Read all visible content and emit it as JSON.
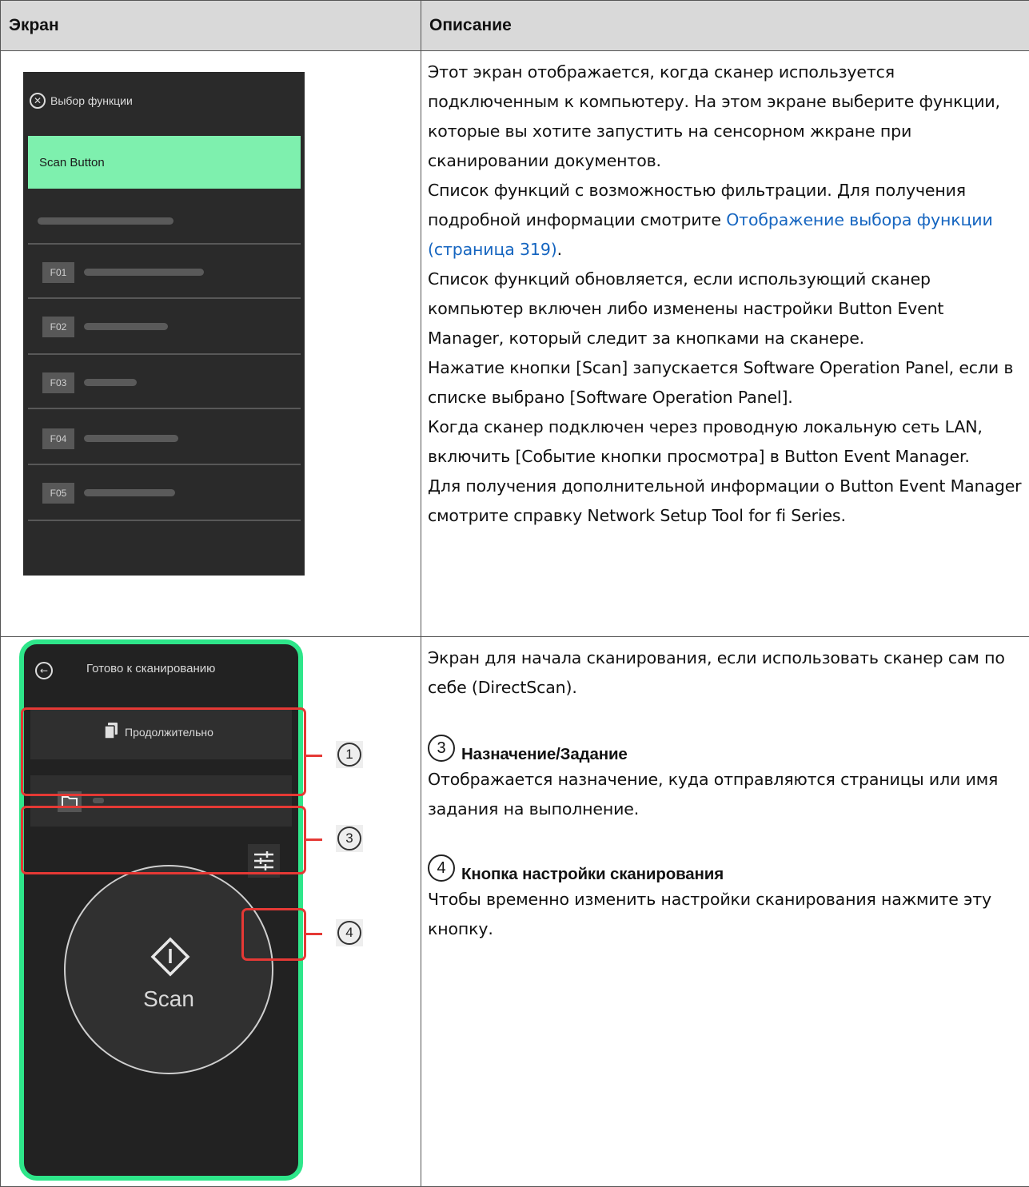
{
  "table": {
    "headers": [
      "Экран",
      "Описание"
    ]
  },
  "row1": {
    "screen": {
      "title": "Выбор функции",
      "selected_item": "Scan Button",
      "function_keys": [
        "F01",
        "F02",
        "F03",
        "F04",
        "F05"
      ]
    },
    "description": {
      "p1": "Этот экран отображается, когда сканер используется подключенным к компьютеру. На этом экране выберите функции, которые вы хотите запустить на сенсорном жкране при сканировании документов.",
      "p2_text": "Список функций с возможностью фильтрации. Для получения подробной информации смотрите ",
      "p2_link": "Отображение выбора функции (страница 319)",
      "p2_end": ".",
      "p3": "Список функций обновляется, если использующий сканер компьютер включен либо изменены настройки Button Event Manager, который следит за кнопками на сканере.",
      "p4": "Нажатие кнопки [Scan] запускается Software Operation Panel, если в списке выбрано [Software Operation Panel].",
      "p5": "Когда сканер подключен через проводную локальную сеть LAN, включить [Событие кнопки просмотра] в Button Event Manager.",
      "p6": "Для получения дополнительной информации о Button Event Manager смотрите справку Network Setup Tool for fi Series."
    }
  },
  "row2": {
    "screen": {
      "title": "Готово к сканированию",
      "continuous_label": "Продолжительно",
      "scan_label": "Scan",
      "callouts": [
        "1",
        "3",
        "4"
      ]
    },
    "description": {
      "intro": "Экран для начала сканирования, если использовать сканер сам по себе (DirectScan).",
      "items": [
        {
          "num": "3",
          "title": "Назначение/Задание",
          "text": "Отображается назначение, куда отправляются страницы или имя задания на выполнение."
        },
        {
          "num": "4",
          "title": "Кнопка настройки сканирования",
          "text": "Чтобы временно изменить настройки сканирования нажмите эту кнопку."
        }
      ]
    }
  },
  "colors": {
    "header_bg": "#d9d9d9",
    "link": "#1565c0",
    "accent_green": "#2ee68a",
    "selected_green": "#7ef0ae",
    "callout_red": "#e53935"
  }
}
